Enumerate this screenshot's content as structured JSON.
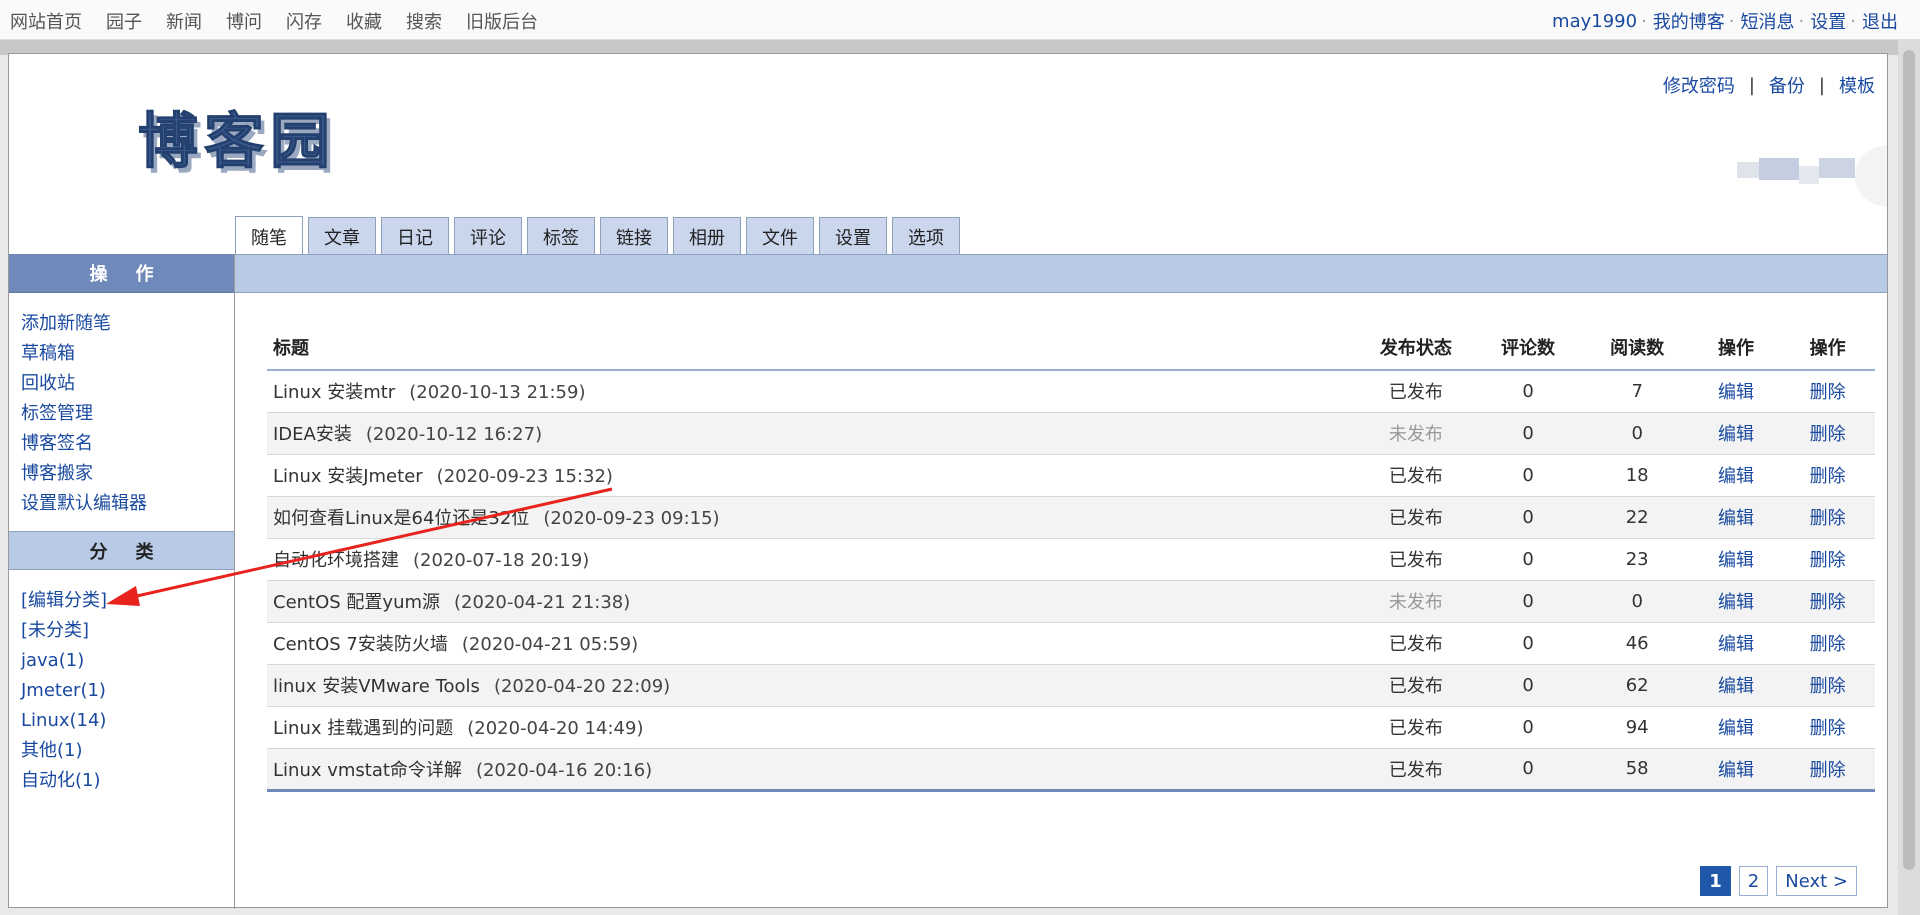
{
  "topnav": [
    "网站首页",
    "园子",
    "新闻",
    "博问",
    "闪存",
    "收藏",
    "搜索",
    "旧版后台"
  ],
  "user": {
    "name": "may1990",
    "links": [
      "我的博客",
      "短消息",
      "设置",
      "退出"
    ]
  },
  "header": {
    "logo_text": "博客园",
    "links": [
      "修改密码",
      "备份",
      "模板"
    ]
  },
  "tabs": [
    "随笔",
    "文章",
    "日记",
    "评论",
    "标签",
    "链接",
    "相册",
    "文件",
    "设置",
    "选项"
  ],
  "sidebar": {
    "ops_title": "操作",
    "ops": [
      "添加新随笔",
      "草稿箱",
      "回收站",
      "标签管理",
      "博客签名",
      "博客搬家",
      "设置默认编辑器"
    ],
    "cat_title": "分类",
    "cats": [
      "[编辑分类]",
      "[未分类]",
      "java(1)",
      "Jmeter(1)",
      "Linux(14)",
      "其他(1)",
      "自动化(1)"
    ]
  },
  "table": {
    "headers": [
      "标题",
      "发布状态",
      "评论数",
      "阅读数",
      "操作",
      "操作"
    ],
    "rows": [
      {
        "title": "Linux 安装mtr",
        "date": "(2020-10-13 21:59)",
        "status": "已发布",
        "comments": "0",
        "reads": "7",
        "edit": "编辑",
        "del": "删除"
      },
      {
        "title": "IDEA安装",
        "date": "(2020-10-12 16:27)",
        "status": "未发布",
        "comments": "0",
        "reads": "0",
        "edit": "编辑",
        "del": "删除"
      },
      {
        "title": "Linux 安装Jmeter",
        "date": "(2020-09-23 15:32)",
        "status": "已发布",
        "comments": "0",
        "reads": "18",
        "edit": "编辑",
        "del": "删除"
      },
      {
        "title": "如何查看Linux是64位还是32位",
        "date": "(2020-09-23 09:15)",
        "status": "已发布",
        "comments": "0",
        "reads": "22",
        "edit": "编辑",
        "del": "删除"
      },
      {
        "title": "自动化环境搭建",
        "date": "(2020-07-18 20:19)",
        "status": "已发布",
        "comments": "0",
        "reads": "23",
        "edit": "编辑",
        "del": "删除"
      },
      {
        "title": "CentOS 配置yum源",
        "date": "(2020-04-21 21:38)",
        "status": "未发布",
        "comments": "0",
        "reads": "0",
        "edit": "编辑",
        "del": "删除"
      },
      {
        "title": "CentOS 7安装防火墙",
        "date": "(2020-04-21 05:59)",
        "status": "已发布",
        "comments": "0",
        "reads": "46",
        "edit": "编辑",
        "del": "删除"
      },
      {
        "title": "linux 安装VMware Tools",
        "date": "(2020-04-20 22:09)",
        "status": "已发布",
        "comments": "0",
        "reads": "62",
        "edit": "编辑",
        "del": "删除"
      },
      {
        "title": "Linux 挂载遇到的问题",
        "date": "(2020-04-20 14:49)",
        "status": "已发布",
        "comments": "0",
        "reads": "94",
        "edit": "编辑",
        "del": "删除"
      },
      {
        "title": "Linux vmstat命令详解",
        "date": "(2020-04-16 20:16)",
        "status": "已发布",
        "comments": "0",
        "reads": "58",
        "edit": "编辑",
        "del": "删除"
      }
    ]
  },
  "pager": {
    "pages": [
      "1",
      "2"
    ],
    "current": "1",
    "next": "Next >"
  },
  "colors": {
    "link": "#1a4aa0",
    "header_dark": "#6f89bb",
    "header_light": "#b8cae6",
    "annotation": "#e8231e"
  }
}
